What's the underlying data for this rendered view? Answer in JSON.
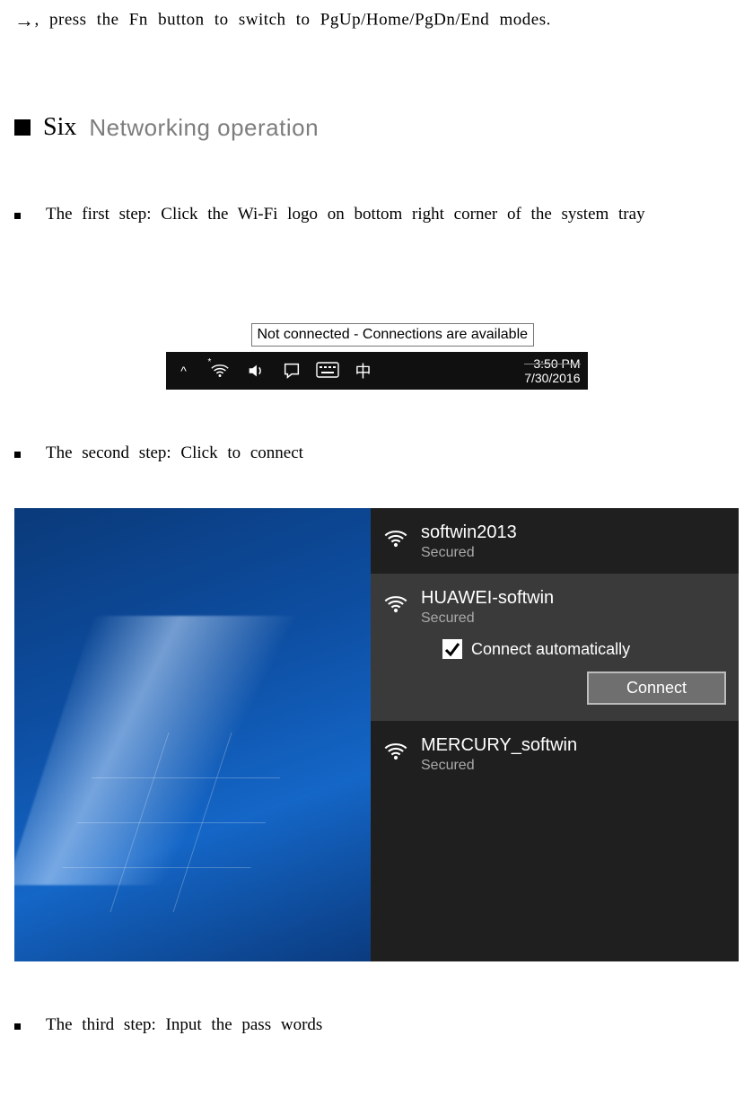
{
  "top_line": ", press the Fn button to switch to PgUp/Home/PgDn/End modes.",
  "section": {
    "num": "Six",
    "title": "Networking operation"
  },
  "steps": {
    "s1": "The first step: Click the Wi-Fi logo on bottom right corner of the system tray",
    "s2": "The second step: Click to connect",
    "s3": "The third step: Input the pass words"
  },
  "tray": {
    "tooltip": "Not connected - Connections are available",
    "ime": "中",
    "time": "3:50 PM",
    "date": "7/30/2016"
  },
  "wifi_panel": {
    "networks": [
      {
        "ssid": "softwin2013",
        "security": "Secured",
        "selected": false,
        "open": false
      },
      {
        "ssid": "HUAWEI-softwin",
        "security": "Secured",
        "selected": true,
        "open": false
      },
      {
        "ssid": "MERCURY_softwin",
        "security": "Secured",
        "selected": false,
        "open": true
      }
    ],
    "auto_label": "Connect automatically",
    "auto_checked": true,
    "connect_label": "Connect"
  }
}
